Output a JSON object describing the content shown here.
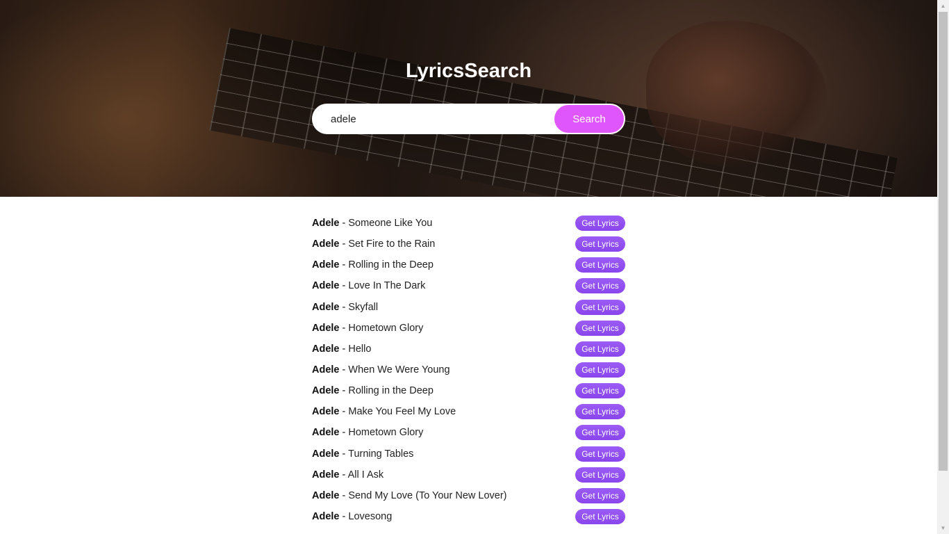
{
  "hero": {
    "title": "LyricsSearch"
  },
  "search": {
    "value": "adele",
    "button_label": "Search"
  },
  "results": [
    {
      "artist": "Adele",
      "separator": " - ",
      "song": "Someone Like You",
      "button": "Get Lyrics"
    },
    {
      "artist": "Adele",
      "separator": " - ",
      "song": "Set Fire to the Rain",
      "button": "Get Lyrics"
    },
    {
      "artist": "Adele",
      "separator": " - ",
      "song": "Rolling in the Deep",
      "button": "Get Lyrics"
    },
    {
      "artist": "Adele",
      "separator": " - ",
      "song": "Love In The Dark",
      "button": "Get Lyrics"
    },
    {
      "artist": "Adele",
      "separator": " - ",
      "song": "Skyfall",
      "button": "Get Lyrics"
    },
    {
      "artist": "Adele",
      "separator": " - ",
      "song": "Hometown Glory",
      "button": "Get Lyrics"
    },
    {
      "artist": "Adele",
      "separator": " - ",
      "song": "Hello",
      "button": "Get Lyrics"
    },
    {
      "artist": "Adele",
      "separator": " - ",
      "song": "When We Were Young",
      "button": "Get Lyrics"
    },
    {
      "artist": "Adele",
      "separator": " - ",
      "song": "Rolling in the Deep",
      "button": "Get Lyrics"
    },
    {
      "artist": "Adele",
      "separator": " - ",
      "song": "Make You Feel My Love",
      "button": "Get Lyrics"
    },
    {
      "artist": "Adele",
      "separator": " - ",
      "song": "Hometown Glory",
      "button": "Get Lyrics"
    },
    {
      "artist": "Adele",
      "separator": " - ",
      "song": "Turning Tables",
      "button": "Get Lyrics"
    },
    {
      "artist": "Adele",
      "separator": " - ",
      "song": "All I Ask",
      "button": "Get Lyrics"
    },
    {
      "artist": "Adele",
      "separator": " - ",
      "song": "Send My Love (To Your New Lover)",
      "button": "Get Lyrics"
    },
    {
      "artist": "Adele",
      "separator": " - ",
      "song": "Lovesong",
      "button": "Get Lyrics"
    }
  ],
  "colors": {
    "search_button": "#e056fd",
    "get_lyrics_button": "#8d4bf0",
    "hero_overlay": "#2b1d16"
  },
  "icons": {
    "scroll_up": "scroll-up-arrow-icon",
    "scroll_down": "scroll-down-arrow-icon"
  }
}
